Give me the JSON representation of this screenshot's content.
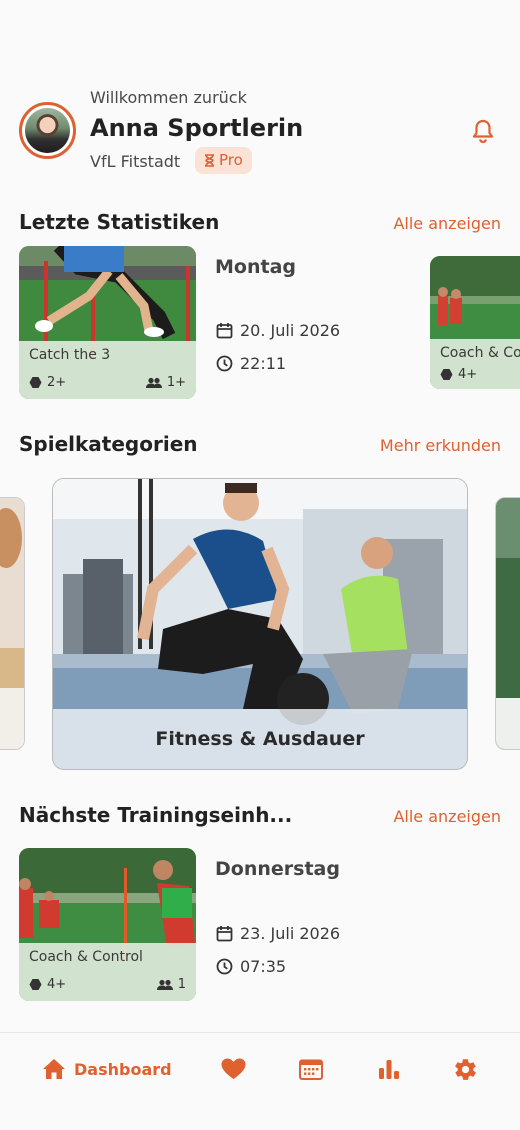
{
  "header": {
    "welcome": "Willkommen zurück",
    "user_name": "Anna Sportlerin",
    "club": "VfL Fitstadt",
    "badge": "Pro"
  },
  "stats": {
    "title": "Letzte Statistiken",
    "link": "Alle anzeigen",
    "card": {
      "name": "Catch the 3",
      "levels": "2+",
      "players": "1+"
    },
    "day": "Montag",
    "date": "20. Juli 2026",
    "time": "22:11",
    "peek_card": {
      "name": "Coach & Co",
      "levels": "4+"
    }
  },
  "categories": {
    "title": "Spielkategorien",
    "link": "Mehr erkunden",
    "active": "Fitness & Ausdauer"
  },
  "next": {
    "title": "Nächste Trainingseinh...",
    "link": "Alle anzeigen",
    "card": {
      "name": "Coach & Control",
      "levels": "4+",
      "players": "1"
    },
    "day": "Donnerstag",
    "date": "23. Juli 2026",
    "time": "07:35"
  },
  "nav": {
    "dashboard": "Dashboard"
  },
  "colors": {
    "accent": "#e0602f",
    "badge_bg": "#fbe2d6",
    "card_info_bg": "#dde9da"
  },
  "icons": [
    "bell-icon",
    "hourglass-icon",
    "calendar-icon",
    "clock-icon",
    "hexagon-icon",
    "people-icon",
    "home-icon",
    "heart-icon",
    "calendar-grid-icon",
    "bar-chart-icon",
    "gear-icon"
  ]
}
